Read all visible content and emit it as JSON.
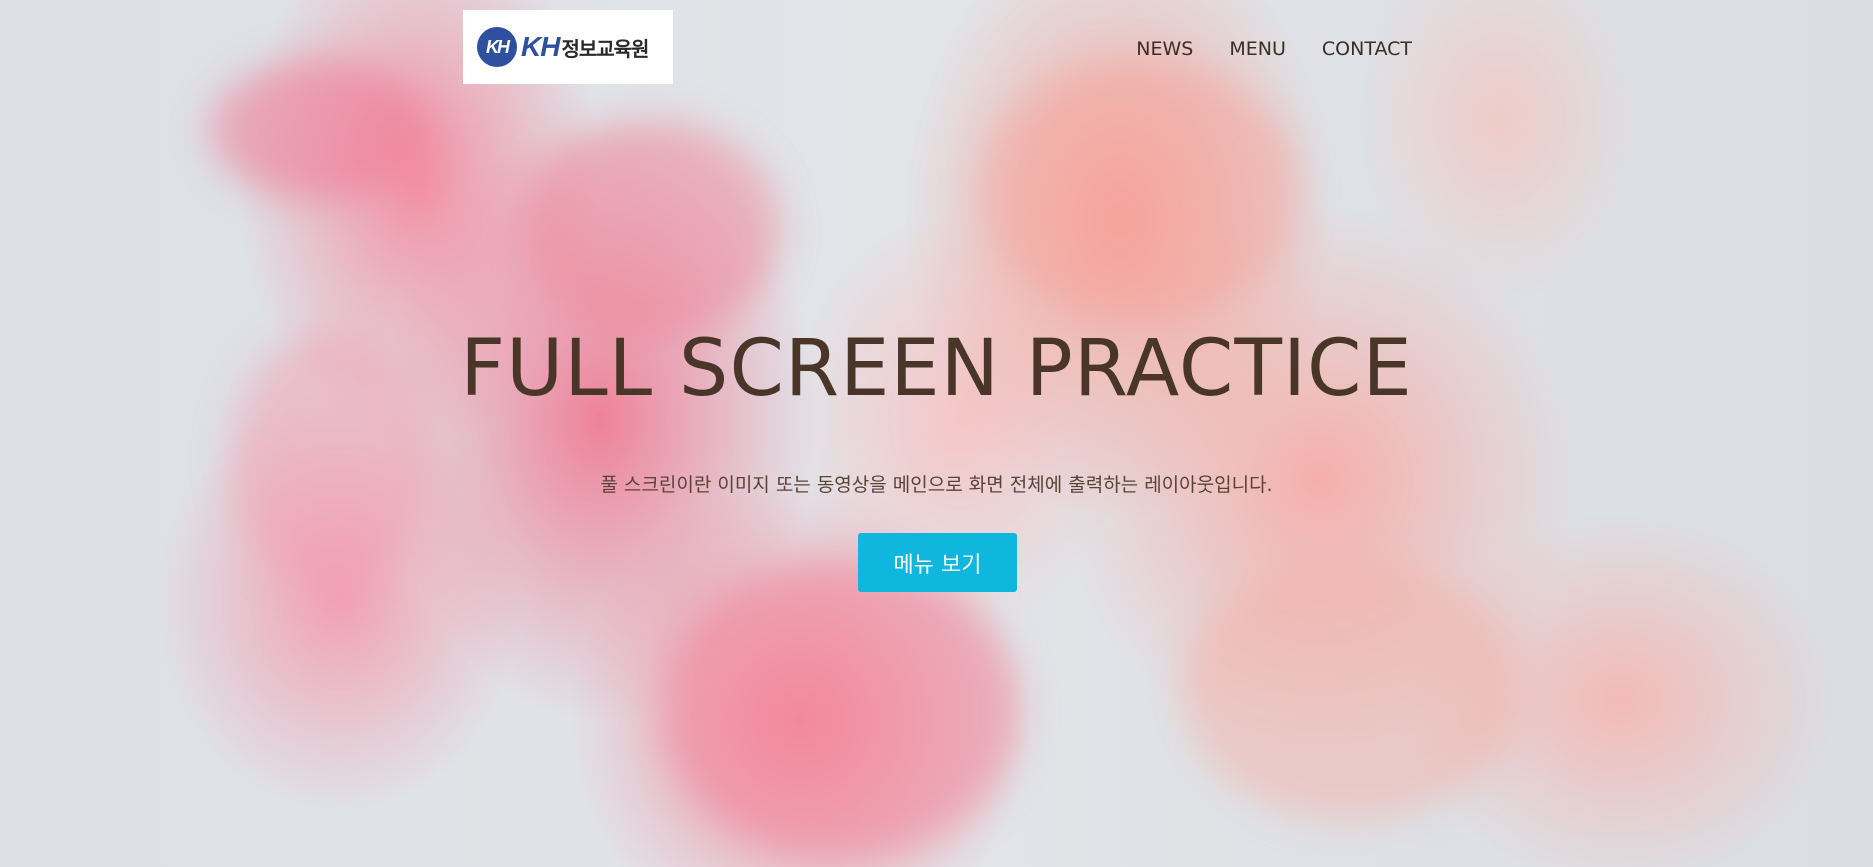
{
  "header": {
    "logo": {
      "mark": "KH",
      "abbr": "KH",
      "name": "정보교육원"
    },
    "nav": [
      {
        "label": "NEWS"
      },
      {
        "label": "MENU"
      },
      {
        "label": "CONTACT"
      }
    ]
  },
  "hero": {
    "title": "FULL SCREEN PRACTICE",
    "description": "풀 스크린이란 이미지 또는 동영상을 메인으로 화면 전체에 출력하는 레이아웃입니다.",
    "button_label": "메뉴 보기"
  },
  "colors": {
    "button_bg": "#10b7dd",
    "title_text": "#4a3629",
    "logo_blue": "#2f4f9f"
  },
  "icons": {
    "logo": "kh-logo-icon"
  }
}
